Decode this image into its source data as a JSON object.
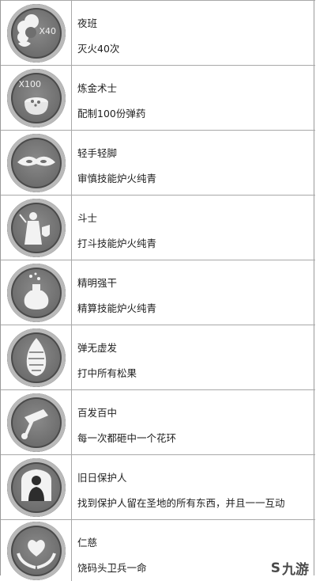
{
  "achievements": [
    {
      "name": "夜班",
      "desc": "灭火40次",
      "mult": "X40",
      "icon": "smoke-icon"
    },
    {
      "name": "炼金术士",
      "desc": "配制100份弹药",
      "mult": "X100",
      "icon": "cauldron-icon"
    },
    {
      "name": "轻手轻脚",
      "desc": "审慎技能炉火纯青",
      "mult": "",
      "icon": "mask-icon"
    },
    {
      "name": "斗士",
      "desc": "打斗技能炉火纯青",
      "mult": "",
      "icon": "fighter-icon"
    },
    {
      "name": "精明强干",
      "desc": "精算技能炉火纯青",
      "mult": "",
      "icon": "flask-icon"
    },
    {
      "name": "弹无虚发",
      "desc": "打中所有松果",
      "mult": "",
      "icon": "pinecone-icon"
    },
    {
      "name": "百发百中",
      "desc": "每一次都砸中一个花环",
      "mult": "",
      "icon": "slingshot-icon"
    },
    {
      "name": "旧日保护人",
      "desc": "找到保护人留在圣地的所有东西，并且一一互动",
      "mult": "",
      "icon": "guardian-icon"
    },
    {
      "name": "仁慈",
      "desc": "饶码头卫兵一命",
      "mult": "",
      "icon": "heart-hands-icon"
    }
  ],
  "watermark": {
    "text": "九游"
  }
}
